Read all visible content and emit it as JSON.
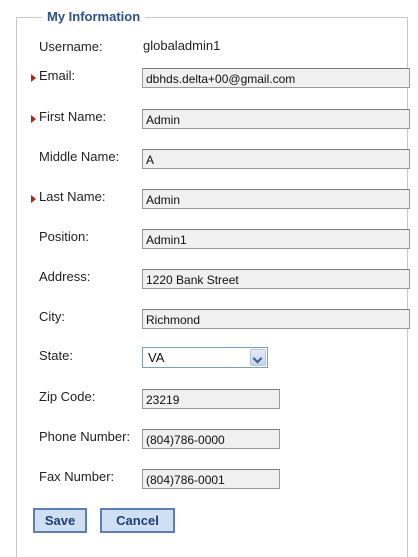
{
  "section": {
    "legend": "My Information"
  },
  "fields": {
    "username": {
      "label": "Username:",
      "value": "globaladmin1",
      "required": false
    },
    "email": {
      "label": "Email:",
      "value": "dbhds.delta+00@gmail.com",
      "required": true
    },
    "first_name": {
      "label": "First Name:",
      "value": "Admin",
      "required": true
    },
    "middle_name": {
      "label": "Middle Name:",
      "value": "A",
      "required": false
    },
    "last_name": {
      "label": "Last Name:",
      "value": "Admin",
      "required": true
    },
    "position": {
      "label": "Position:",
      "value": "Admin1",
      "required": false
    },
    "address": {
      "label": "Address:",
      "value": "1220 Bank Street",
      "required": false
    },
    "city": {
      "label": "City:",
      "value": "Richmond",
      "required": false
    },
    "state": {
      "label": "State:",
      "value": "VA",
      "required": false
    },
    "zip": {
      "label": "Zip Code:",
      "value": "23219",
      "required": false
    },
    "phone": {
      "label": "Phone Number:",
      "value": "(804)786-0000",
      "required": false
    },
    "fax": {
      "label": "Fax Number:",
      "value": "(804)786-0001",
      "required": false
    }
  },
  "buttons": {
    "save": "Save",
    "cancel": "Cancel"
  },
  "colors": {
    "legend": "#2c4f8f",
    "required_marker": "#c41a1a",
    "button_bg": "#cfe0f3",
    "button_border": "#5b7fb5",
    "button_text": "#1f3d78"
  }
}
